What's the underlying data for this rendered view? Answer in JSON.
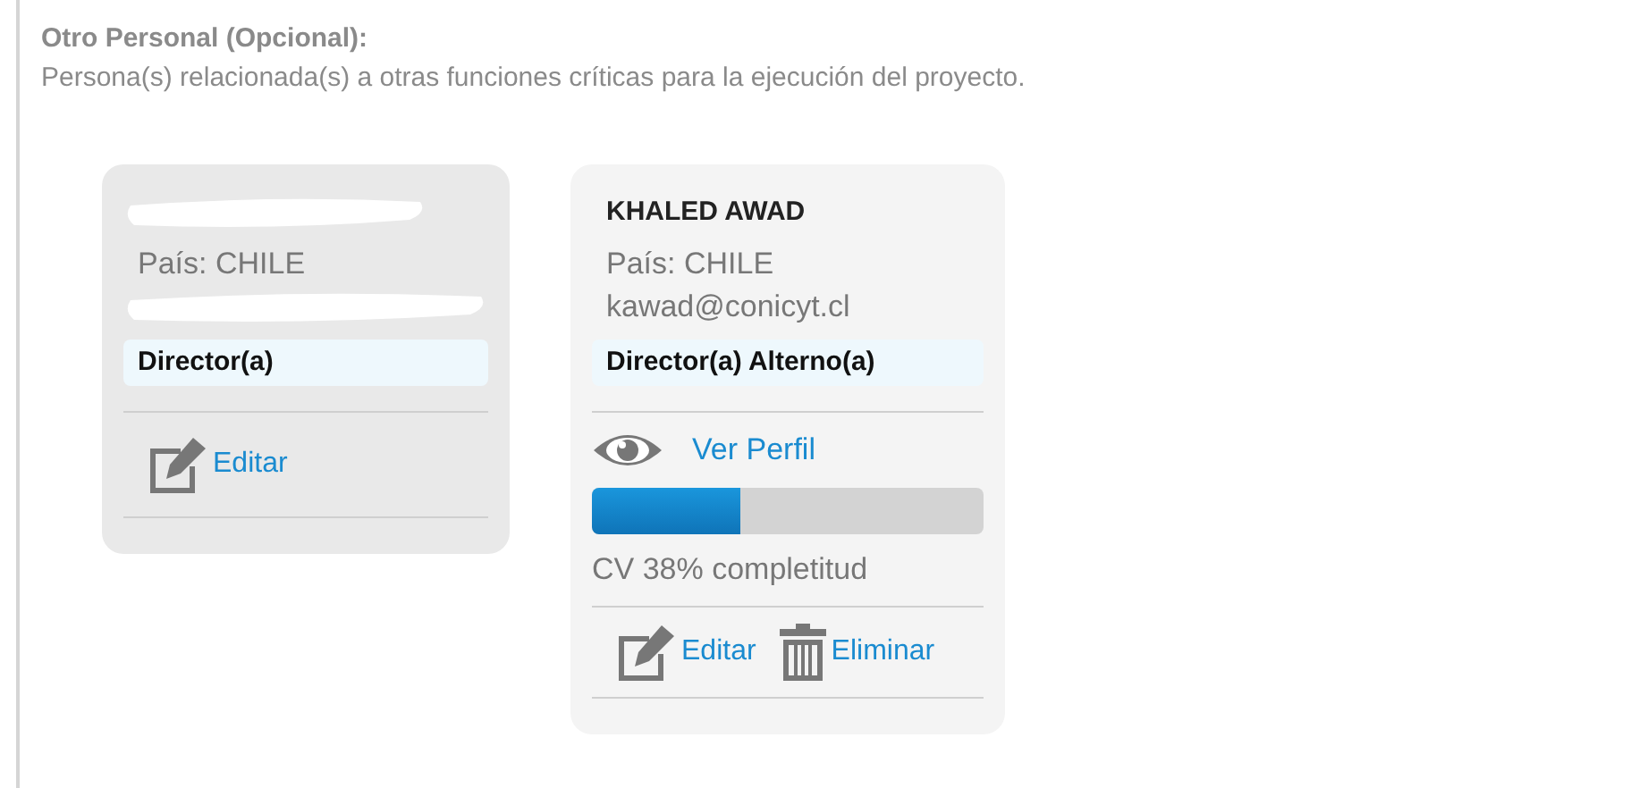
{
  "section": {
    "title": "Otro Personal (Opcional):",
    "description": "Persona(s) relacionada(s) a otras funciones críticas para la ejecución del proyecto."
  },
  "cards": [
    {
      "selected": true,
      "redacted": true,
      "country": "País: CHILE",
      "role": "Director(a)",
      "actions": [
        {
          "kind": "edit",
          "label": "Editar"
        }
      ]
    },
    {
      "selected": false,
      "redacted": false,
      "name": "KHALED AWAD",
      "country": "País: CHILE",
      "email": "kawad@conicyt.cl",
      "role": "Director(a) Alterno(a)",
      "profile_link": "Ver Perfil",
      "progress": {
        "level": 0.38,
        "caption": "CV 38% completitud"
      },
      "actions": [
        {
          "kind": "edit",
          "label": "Editar"
        },
        {
          "kind": "delete",
          "label": "Eliminar"
        }
      ]
    }
  ]
}
